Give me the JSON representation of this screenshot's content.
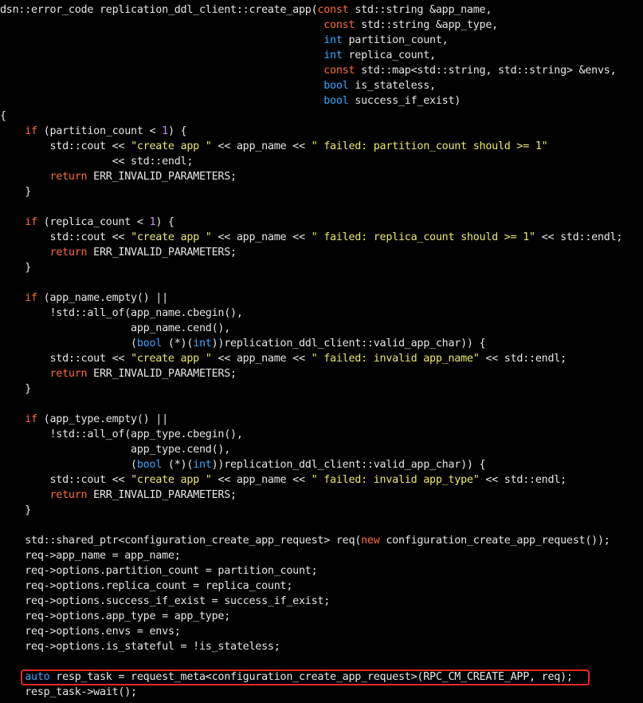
{
  "colors": {
    "background": "#000000",
    "plain": "#e6e6e6",
    "keyword": "#ff6a3d",
    "type": "#3ea6ff",
    "number": "#c28cff",
    "string": "#e9e96f",
    "highlight_border": "#e8291f"
  },
  "highlighted_line_index": 44,
  "lines": [
    [
      [
        "p",
        "dsn::error_code replication_ddl_client::create_app("
      ],
      [
        "k",
        "const"
      ],
      [
        "p",
        " std::string &app_name,"
      ]
    ],
    [
      [
        "p",
        "                                                    "
      ],
      [
        "k",
        "const"
      ],
      [
        "p",
        " std::string &app_type,"
      ]
    ],
    [
      [
        "p",
        "                                                    "
      ],
      [
        "t",
        "int"
      ],
      [
        "p",
        " partition_count,"
      ]
    ],
    [
      [
        "p",
        "                                                    "
      ],
      [
        "t",
        "int"
      ],
      [
        "p",
        " replica_count,"
      ]
    ],
    [
      [
        "p",
        "                                                    "
      ],
      [
        "k",
        "const"
      ],
      [
        "p",
        " std::map<std::string, std::string> &envs,"
      ]
    ],
    [
      [
        "p",
        "                                                    "
      ],
      [
        "t",
        "bool"
      ],
      [
        "p",
        " is_stateless,"
      ]
    ],
    [
      [
        "p",
        "                                                    "
      ],
      [
        "t",
        "bool"
      ],
      [
        "p",
        " success_if_exist)"
      ]
    ],
    [
      [
        "p",
        "{"
      ]
    ],
    [
      [
        "p",
        "    "
      ],
      [
        "k",
        "if"
      ],
      [
        "p",
        " (partition_count < "
      ],
      [
        "n",
        "1"
      ],
      [
        "p",
        ") {"
      ]
    ],
    [
      [
        "p",
        "        std::cout << "
      ],
      [
        "s",
        "\"create app \""
      ],
      [
        "p",
        " << app_name << "
      ],
      [
        "s",
        "\" failed: partition_count should >= 1\""
      ]
    ],
    [
      [
        "p",
        "                  << std::endl;"
      ]
    ],
    [
      [
        "p",
        "        "
      ],
      [
        "k",
        "return"
      ],
      [
        "p",
        " ERR_INVALID_PARAMETERS;"
      ]
    ],
    [
      [
        "p",
        "    }"
      ]
    ],
    [
      [
        "p",
        ""
      ]
    ],
    [
      [
        "p",
        "    "
      ],
      [
        "k",
        "if"
      ],
      [
        "p",
        " (replica_count < "
      ],
      [
        "n",
        "1"
      ],
      [
        "p",
        ") {"
      ]
    ],
    [
      [
        "p",
        "        std::cout << "
      ],
      [
        "s",
        "\"create app \""
      ],
      [
        "p",
        " << app_name << "
      ],
      [
        "s",
        "\" failed: replica_count should >= 1\""
      ],
      [
        "p",
        " << std::endl;"
      ]
    ],
    [
      [
        "p",
        "        "
      ],
      [
        "k",
        "return"
      ],
      [
        "p",
        " ERR_INVALID_PARAMETERS;"
      ]
    ],
    [
      [
        "p",
        "    }"
      ]
    ],
    [
      [
        "p",
        ""
      ]
    ],
    [
      [
        "p",
        "    "
      ],
      [
        "k",
        "if"
      ],
      [
        "p",
        " (app_name.empty() ||"
      ]
    ],
    [
      [
        "p",
        "        !std::all_of(app_name.cbegin(),"
      ]
    ],
    [
      [
        "p",
        "                     app_name.cend(),"
      ]
    ],
    [
      [
        "p",
        "                     ("
      ],
      [
        "t",
        "bool"
      ],
      [
        "p",
        " (*)("
      ],
      [
        "t",
        "int"
      ],
      [
        "p",
        "))replication_ddl_client::valid_app_char)) {"
      ]
    ],
    [
      [
        "p",
        "        std::cout << "
      ],
      [
        "s",
        "\"create app \""
      ],
      [
        "p",
        " << app_name << "
      ],
      [
        "s",
        "\" failed: invalid app_name\""
      ],
      [
        "p",
        " << std::endl;"
      ]
    ],
    [
      [
        "p",
        "        "
      ],
      [
        "k",
        "return"
      ],
      [
        "p",
        " ERR_INVALID_PARAMETERS;"
      ]
    ],
    [
      [
        "p",
        "    }"
      ]
    ],
    [
      [
        "p",
        ""
      ]
    ],
    [
      [
        "p",
        "    "
      ],
      [
        "k",
        "if"
      ],
      [
        "p",
        " (app_type.empty() ||"
      ]
    ],
    [
      [
        "p",
        "        !std::all_of(app_type.cbegin(),"
      ]
    ],
    [
      [
        "p",
        "                     app_type.cend(),"
      ]
    ],
    [
      [
        "p",
        "                     ("
      ],
      [
        "t",
        "bool"
      ],
      [
        "p",
        " (*)("
      ],
      [
        "t",
        "int"
      ],
      [
        "p",
        "))replication_ddl_client::valid_app_char)) {"
      ]
    ],
    [
      [
        "p",
        "        std::cout << "
      ],
      [
        "s",
        "\"create app \""
      ],
      [
        "p",
        " << app_name << "
      ],
      [
        "s",
        "\" failed: invalid app_type\""
      ],
      [
        "p",
        " << std::endl;"
      ]
    ],
    [
      [
        "p",
        "        "
      ],
      [
        "k",
        "return"
      ],
      [
        "p",
        " ERR_INVALID_PARAMETERS;"
      ]
    ],
    [
      [
        "p",
        "    }"
      ]
    ],
    [
      [
        "p",
        ""
      ]
    ],
    [
      [
        "p",
        "    std::shared_ptr<configuration_create_app_request> req("
      ],
      [
        "k",
        "new"
      ],
      [
        "p",
        " configuration_create_app_request());"
      ]
    ],
    [
      [
        "p",
        "    req->app_name = app_name;"
      ]
    ],
    [
      [
        "p",
        "    req->options.partition_count = partition_count;"
      ]
    ],
    [
      [
        "p",
        "    req->options.replica_count = replica_count;"
      ]
    ],
    [
      [
        "p",
        "    req->options.success_if_exist = success_if_exist;"
      ]
    ],
    [
      [
        "p",
        "    req->options.app_type = app_type;"
      ]
    ],
    [
      [
        "p",
        "    req->options.envs = envs;"
      ]
    ],
    [
      [
        "p",
        "    req->options.is_stateful = !is_stateless;"
      ]
    ],
    [
      [
        "p",
        ""
      ]
    ],
    [
      [
        "p",
        "    "
      ],
      [
        "t",
        "auto"
      ],
      [
        "p",
        " resp_task = request_meta<configuration_create_app_request>(RPC_CM_CREATE_APP, req);"
      ]
    ],
    [
      [
        "p",
        "    resp_task->wait();"
      ]
    ]
  ]
}
